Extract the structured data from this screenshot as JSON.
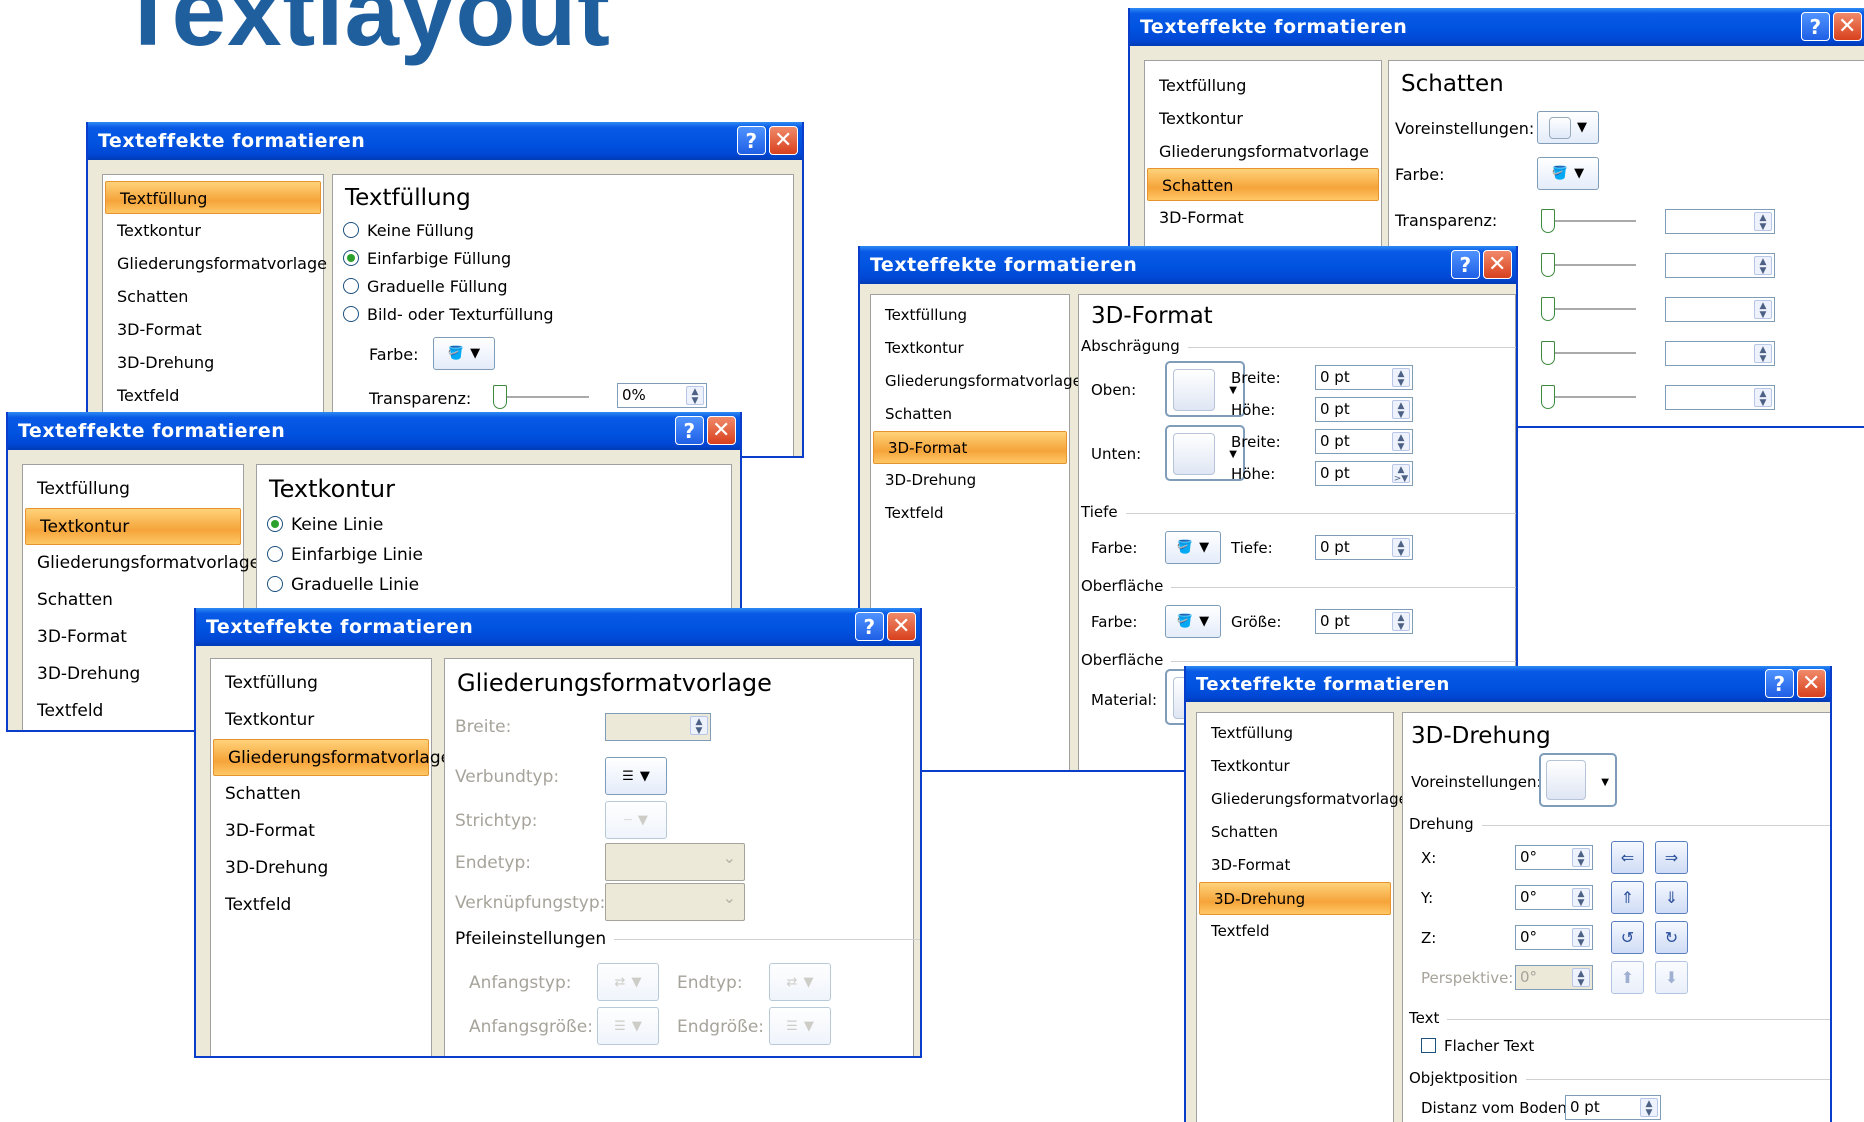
{
  "page_title": "Textlayout",
  "dialog_title": "Texteffekte formatieren",
  "title_buttons": {
    "help": "?",
    "close": "✕"
  },
  "nav": [
    "Textfüllung",
    "Textkontur",
    "Gliederungsformatvorlage",
    "Schatten",
    "3D-Format",
    "3D-Drehung",
    "Textfeld"
  ],
  "textfuellung": {
    "heading": "Textfüllung",
    "options": [
      "Keine Füllung",
      "Einfarbige Füllung",
      "Graduelle Füllung",
      "Bild- oder Texturfüllung"
    ],
    "selected": "Einfarbige Füllung",
    "farbe_label": "Farbe:",
    "transparenz_label": "Transparenz:",
    "transparenz_value": "0%"
  },
  "textkontur": {
    "heading": "Textkontur",
    "options": [
      "Keine Linie",
      "Einfarbige Linie",
      "Graduelle Linie"
    ],
    "selected": "Keine Linie"
  },
  "gliederung": {
    "heading": "Gliederungsformatvorlage",
    "breite": "Breite:",
    "verbundtyp": "Verbundtyp:",
    "strichtyp": "Strichtyp:",
    "endetyp": "Endetyp:",
    "verknuepfungstyp": "Verknüpfungstyp:",
    "pfeil_section": "Pfeileinstellungen",
    "anfangstyp": "Anfangstyp:",
    "endtyp": "Endtyp:",
    "anfangsgroesse": "Anfangsgröße:",
    "endgroesse": "Endgröße:"
  },
  "schatten": {
    "heading": "Schatten",
    "voreinstellungen": "Voreinstellungen:",
    "farbe": "Farbe:",
    "transparenz": "Transparenz:"
  },
  "format3d": {
    "heading": "3D-Format",
    "abschraegung": "Abschrägung",
    "oben": "Oben:",
    "unten": "Unten:",
    "breite": "Breite:",
    "hoehe": "Höhe:",
    "value": "0 pt",
    "tiefe_section": "Tiefe",
    "farbe": "Farbe:",
    "tiefe": "Tiefe:",
    "oberflaeche_section": "Oberfläche",
    "farbe2": "Farbe:",
    "groesse": "Größe:",
    "oberflaeche_section2": "Oberfläche",
    "material": "Material:"
  },
  "drehung3d": {
    "heading": "3D-Drehung",
    "voreinstellungen": "Voreinstellungen:",
    "drehung_section": "Drehung",
    "x": "X:",
    "y": "Y:",
    "z": "Z:",
    "deg": "0°",
    "perspektive": "Perspektive:",
    "text_section": "Text",
    "flacher_text": "Flacher Text",
    "objektposition_section": "Objektposition",
    "distanz": "Distanz vom Boden:",
    "distanz_value": "0 pt"
  }
}
